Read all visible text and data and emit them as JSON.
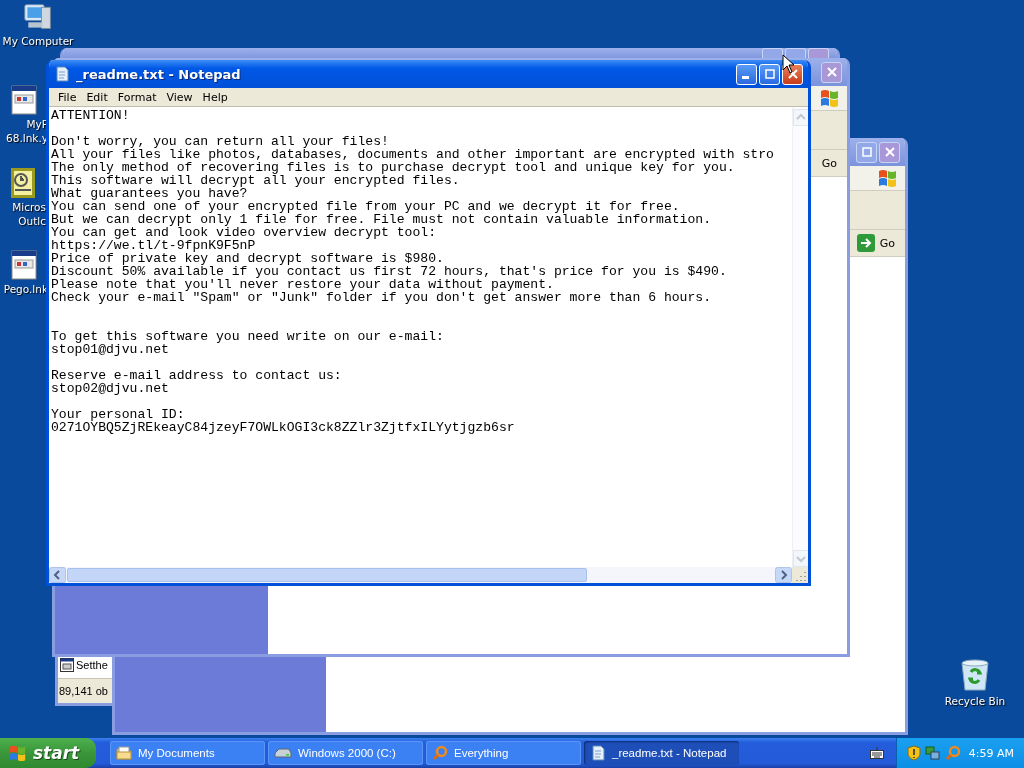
{
  "desktop_icons": [
    {
      "label": "My Computer",
      "kind": "computer"
    },
    {
      "label": "MyP\n68.lnk.y",
      "kind": "shortcut"
    },
    {
      "label": "Micros\nOutlc",
      "kind": "outlook"
    },
    {
      "label": "Pego.lnk",
      "kind": "shortcut"
    },
    {
      "label": "Recycle Bin",
      "kind": "recycle"
    }
  ],
  "explorer_windows": [
    {
      "go": "Go"
    },
    {
      "go": "Go"
    }
  ],
  "file_window": {
    "item": "Setthe",
    "status": "89,141 ob"
  },
  "notepad": {
    "title": "_readme.txt - Notepad",
    "menu": [
      "File",
      "Edit",
      "Format",
      "View",
      "Help"
    ],
    "text": "ATTENTION!\n\nDon't worry, you can return all your files!\nAll your files like photos, databases, documents and other important are encrypted with stro\nThe only method of recovering files is to purchase decrypt tool and unique key for you.\nThis software will decrypt all your encrypted files.\nWhat guarantees you have?\nYou can send one of your encrypted file from your PC and we decrypt it for free.\nBut we can decrypt only 1 file for free. File must not contain valuable information.\nYou can get and look video overview decrypt tool:\nhttps://we.tl/t-9fpnK9F5nP\nPrice of private key and decrypt software is $980.\nDiscount 50% available if you contact us first 72 hours, that's price for you is $490.\nPlease note that you'll never restore your data without payment.\nCheck your e-mail \"Spam\" or \"Junk\" folder if you don't get answer more than 6 hours.\n\n\nTo get this software you need write on our e-mail:\nstop01@djvu.net\n\nReserve e-mail address to contact us:\nstop02@djvu.net\n\nYour personal ID:\n0271OYBQ5ZjREkeayC84jzeyF7OWLkOGI3ck8ZZlr3ZjtfxILYytjgzb6sr"
  },
  "taskbar": {
    "start": "start",
    "tasks": [
      {
        "label": "My Documents",
        "kind": "folder",
        "selected": false
      },
      {
        "label": "Windows 2000 (C:)",
        "kind": "drive",
        "selected": false
      },
      {
        "label": "Everything",
        "kind": "search",
        "selected": false
      },
      {
        "label": "_readme.txt - Notepad",
        "kind": "notepad",
        "selected": true
      }
    ],
    "clock": "4:59 AM"
  }
}
